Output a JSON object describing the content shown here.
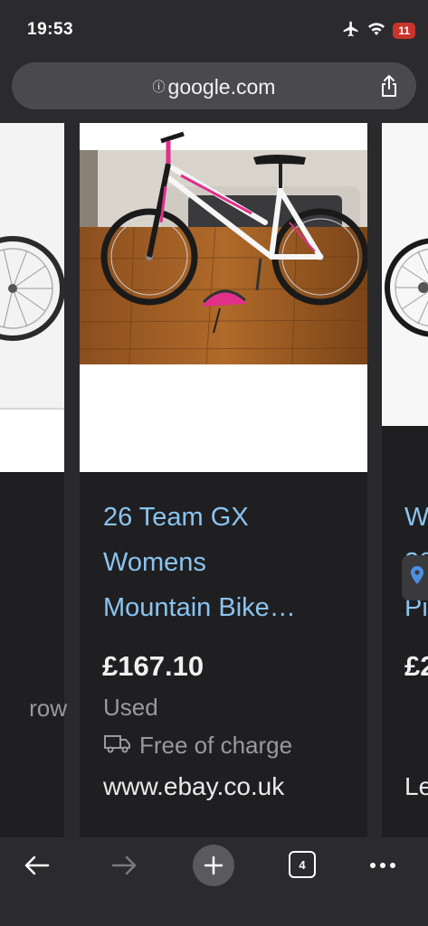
{
  "status": {
    "time": "19:53",
    "battery": "11"
  },
  "browser": {
    "url": "google.com",
    "open_tabs": "4"
  },
  "cards": {
    "left": {
      "snippet": "row"
    },
    "main": {
      "title_lines": [
        "26 Team GX",
        "Womens",
        "Mountain Bike…"
      ],
      "price": "£167.10",
      "condition": "Used",
      "shipping": "Free of charge",
      "site": "www.ebay.co.uk"
    },
    "right": {
      "title_lines": [
        "W",
        "20",
        "Pi"
      ],
      "price": "£2",
      "site": "Le"
    }
  },
  "colors": {
    "link": "#8ac4f0",
    "card_bg": "#1f1f21",
    "bar_bg": "#2b2b2e",
    "battery": "#c9342c"
  },
  "icons": [
    "airplane-icon",
    "wifi-icon",
    "battery-icon",
    "info-icon",
    "share-icon",
    "truck-icon",
    "location-pin-icon",
    "back-icon",
    "forward-icon",
    "plus-icon",
    "tabs-icon",
    "more-icon"
  ]
}
